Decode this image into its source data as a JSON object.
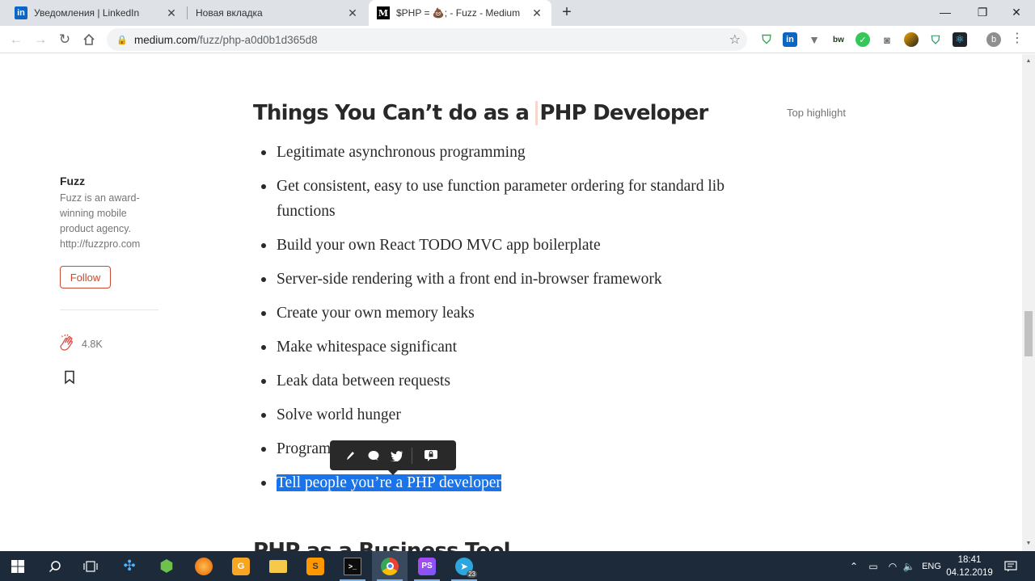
{
  "browser": {
    "tabs": [
      {
        "title": "Уведомления | LinkedIn",
        "icon": "linkedin-icon",
        "favicon_text": "in",
        "color": "#0a66c2"
      },
      {
        "title": "Новая вкладка",
        "icon": "new-tab-icon",
        "favicon_text": "",
        "color": "#dee1e6"
      },
      {
        "title": "$PHP = 💩; - Fuzz - Medium",
        "icon": "medium-icon",
        "favicon_text": "M",
        "color": "#000000"
      }
    ],
    "window_controls": {
      "minimize": "—",
      "maximize": "❐",
      "close": "✕"
    },
    "address": {
      "host": "medium.com",
      "path": "/fuzz/php-a0d0b1d365d8"
    },
    "profile_initial": "b"
  },
  "article": {
    "heading_part1": "Things You Can’t do as a ",
    "heading_part2": "PHP Developer",
    "top_highlight": "Top highlight",
    "list": [
      "Legitimate asynchronous programming",
      "Get consistent, easy to use function parameter ordering for standard lib functions",
      "Build your own React TODO MVC app boilerplate",
      "Server-side rendering with a front end in-browser framework",
      "Create your own memory leaks",
      "Make whitespace significant",
      "Leak data between requests",
      "Solve world hunger",
      "Program"
    ],
    "selected_item": "Tell people you’re a PHP developer",
    "next_heading": "PHP as a Business Tool"
  },
  "sidebar": {
    "author": "Fuzz",
    "bio": "Fuzz is an award-winning mobile product agency. http://fuzzpro.com",
    "follow_label": "Follow",
    "clap_count": "4.8K"
  },
  "taskbar": {
    "language": "ENG",
    "time": "18:41",
    "date": "04.12.2019",
    "telegram_badge": "23"
  }
}
